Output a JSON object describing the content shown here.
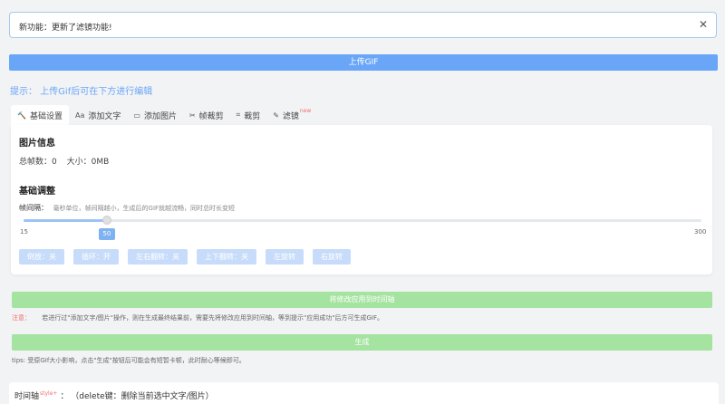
{
  "notice": {
    "text": "新功能：更新了滤镜功能!",
    "close_icon": "close-icon"
  },
  "upload_button": "上传GIF",
  "tip": "提示：  上传Gif后可在下方进行编辑",
  "tabs": [
    {
      "label": "基础设置",
      "icon": "wrench-icon",
      "glyph": "🔨"
    },
    {
      "label": "添加文字",
      "icon": "text-icon",
      "glyph": "Aa"
    },
    {
      "label": "添加图片",
      "icon": "image-icon",
      "glyph": "▭"
    },
    {
      "label": "帧裁剪",
      "icon": "scissors-icon",
      "glyph": "✂"
    },
    {
      "label": "裁剪",
      "icon": "crop-icon",
      "glyph": "⌗"
    },
    {
      "label": "滤镜",
      "icon": "magic-wand-icon",
      "glyph": "✎",
      "badge": "new"
    }
  ],
  "image_info": {
    "title": "图片信息",
    "frames": "总帧数：0",
    "size": "大小：0MB"
  },
  "basic_adjust": {
    "title": "基础调整",
    "interval_label": "帧间隔：",
    "interval_desc": "毫秒单位，帧间隔越小，生成后的GIF就越流畅，同时总时长变短",
    "slider": {
      "min": "15",
      "max": "300",
      "value": "50",
      "min_num": 15,
      "max_num": 300,
      "value_num": 50
    }
  },
  "controls": [
    "倒放：关",
    "循环：开",
    "左右翻转：关",
    "上下翻转：关",
    "左旋转",
    "右旋转"
  ],
  "apply_button": "将修改应用到时间轴",
  "warning": {
    "label": "注意：",
    "text": "若进行过\"添加文字/图片\"操作，则在生成最终结果前，需要先将修改应用到时间轴，等到提示\"应用成功\"后方可生成GIF。"
  },
  "generate_button": "生成",
  "tips": "tips: 受原GIf大小影响，点击\"生成\"按钮后可能会有短暂卡顿，此时耐心等候即可。",
  "timeline": {
    "label": "时间轴",
    "style_tag": "style+",
    "hint": "：  （delete键：删除当前选中文字/图片）"
  },
  "colors": {
    "primary": "#6aa6f8",
    "success": "#a5e3a0",
    "danger": "#f56c6c",
    "button_disabled": "#c7dcfa"
  }
}
